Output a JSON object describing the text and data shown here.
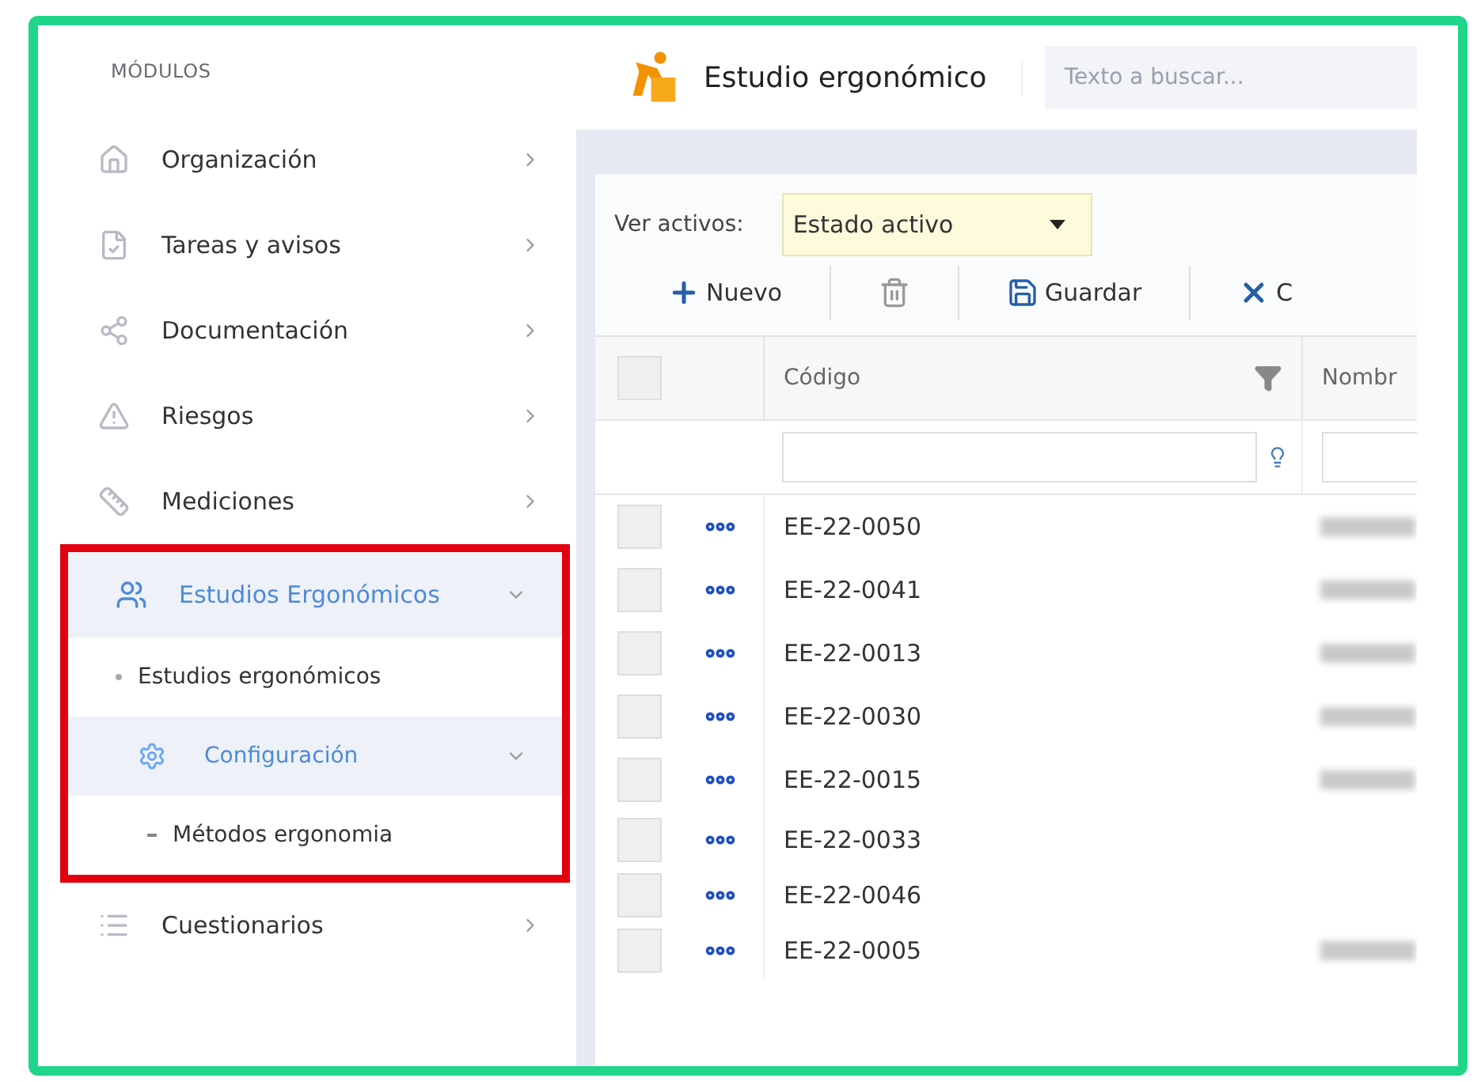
{
  "sidebar": {
    "heading": "MÓDULOS",
    "items": [
      {
        "label": "Organización",
        "expanded": false
      },
      {
        "label": "Tareas y avisos",
        "expanded": false
      },
      {
        "label": "Documentación",
        "expanded": false
      },
      {
        "label": "Riesgos",
        "expanded": false
      },
      {
        "label": "Mediciones",
        "expanded": false
      },
      {
        "label": "Estudios Ergonómicos",
        "expanded": true,
        "highlighted": true,
        "children": [
          {
            "label": "Estudios ergonómicos",
            "expanded": false
          },
          {
            "label": "Configuración",
            "expanded": true,
            "children": [
              {
                "label": "Métodos ergonomia",
                "expanded": false
              }
            ]
          }
        ]
      },
      {
        "label": "Cuestionarios",
        "expanded": false
      }
    ]
  },
  "header": {
    "title": "Estudio ergonómico",
    "search": {
      "placeholder": "Texto a buscar..."
    }
  },
  "filter": {
    "label": "Ver activos:",
    "value": "Estado activo"
  },
  "toolbar": [
    {
      "kind": "add",
      "label": "Nuevo"
    },
    {
      "kind": "delete"
    },
    {
      "kind": "save",
      "label": "Guardar"
    },
    {
      "kind": "cancel",
      "label": "C"
    }
  ],
  "table": {
    "select_all_checked": false,
    "columns": [
      "Código",
      "Nombr"
    ],
    "rows": [
      {
        "code": "EE-22-0050",
        "checked": false,
        "name_redacted": true
      },
      {
        "code": "EE-22-0041",
        "checked": false,
        "name_redacted": true
      },
      {
        "code": "EE-22-0013",
        "checked": false,
        "name_redacted": true
      },
      {
        "code": "EE-22-0030",
        "checked": false,
        "name_redacted": true
      },
      {
        "code": "EE-22-0015",
        "checked": false,
        "name_redacted": true
      },
      {
        "code": "EE-22-0033",
        "checked": false,
        "name_redacted": false
      },
      {
        "code": "EE-22-0046",
        "checked": false,
        "name_redacted": false
      },
      {
        "code": "EE-22-0005",
        "checked": false,
        "name_redacted": true
      }
    ]
  }
}
